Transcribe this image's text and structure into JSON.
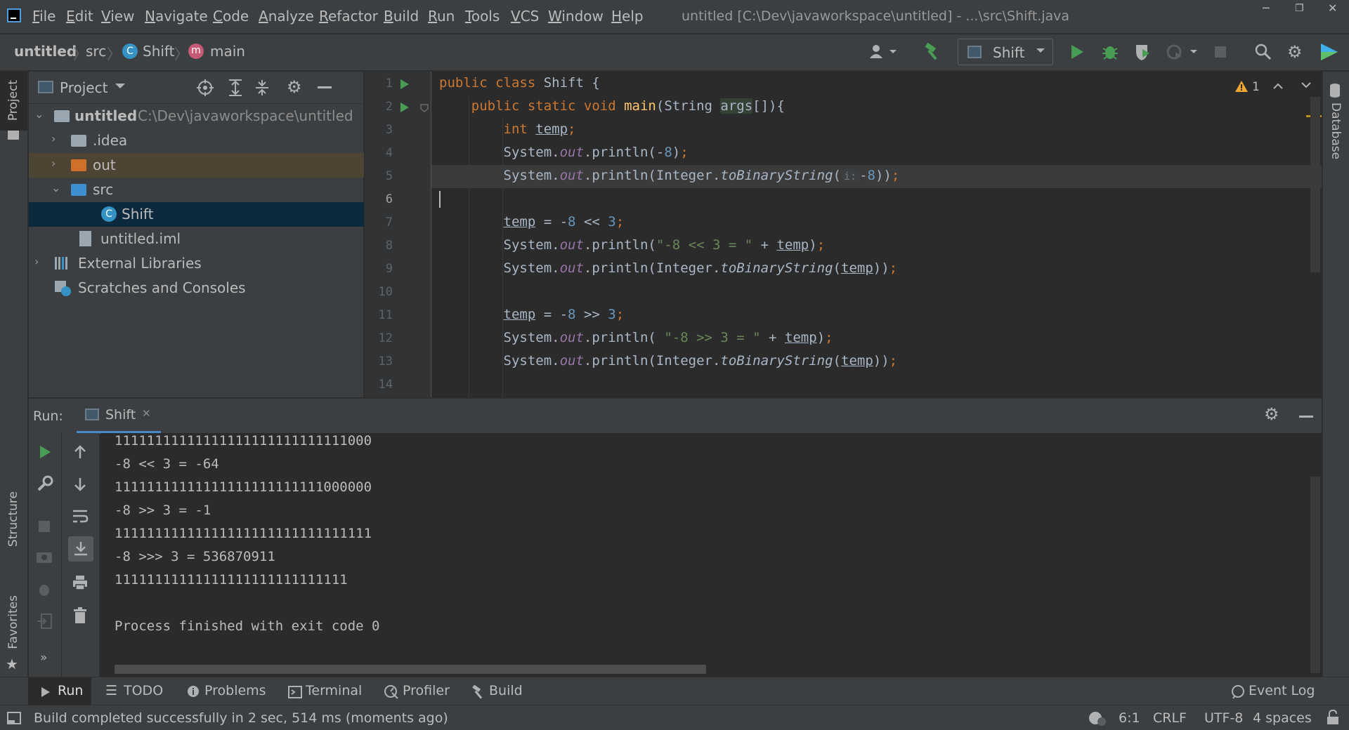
{
  "menu": [
    "File",
    "Edit",
    "View",
    "Navigate",
    "Code",
    "Analyze",
    "Refactor",
    "Build",
    "Run",
    "Tools",
    "VCS",
    "Window",
    "Help"
  ],
  "window_title": "untitled [C:\\Dev\\javaworkspace\\untitled] - ...\\src\\Shift.java",
  "breadcrumb": {
    "project": "untitled",
    "src": "src",
    "class": "Shift",
    "method": "main"
  },
  "run_config": "Shift",
  "left_tabs": {
    "project": "Project",
    "structure": "Structure",
    "favorites": "Favorites"
  },
  "right_tabs": {
    "database": "Database"
  },
  "project_panel": {
    "title": "Project",
    "root_name": "untitled",
    "root_path": "C:\\Dev\\javaworkspace\\untitled",
    "items": [
      ".idea",
      "out",
      "src",
      "Shift",
      "untitled.iml",
      "External Libraries",
      "Scratches and Consoles"
    ]
  },
  "editor": {
    "warnings": "1",
    "line_numbers": [
      "1",
      "2",
      "3",
      "4",
      "5",
      "6",
      "7",
      "8",
      "9",
      "10",
      "11",
      "12",
      "13",
      "14"
    ],
    "param_hint": "i:"
  },
  "run_panel": {
    "label": "Run:",
    "tab": "Shift",
    "output": [
      "11111111111111111111111111111000",
      "-8 << 3 = -64",
      "11111111111111111111111111000000",
      "-8 >> 3 = -1",
      "11111111111111111111111111111111",
      "-8 >>> 3 = 536870911",
      "11111111111111111111111111111",
      "",
      "Process finished with exit code 0"
    ]
  },
  "bottom_tabs": [
    "Run",
    "TODO",
    "Problems",
    "Terminal",
    "Profiler",
    "Build"
  ],
  "event_log": "Event Log",
  "status": {
    "message": "Build completed successfully in 2 sec, 514 ms (moments ago)",
    "position": "6:1",
    "line_sep": "CRLF",
    "encoding": "UTF-8",
    "indent": "4 spaces"
  },
  "colors": {
    "accent_green": "#499c54",
    "selection": "#0d293e",
    "keyword": "#cc7832",
    "number": "#6897bb",
    "string": "#6a8759",
    "field": "#9876aa"
  }
}
